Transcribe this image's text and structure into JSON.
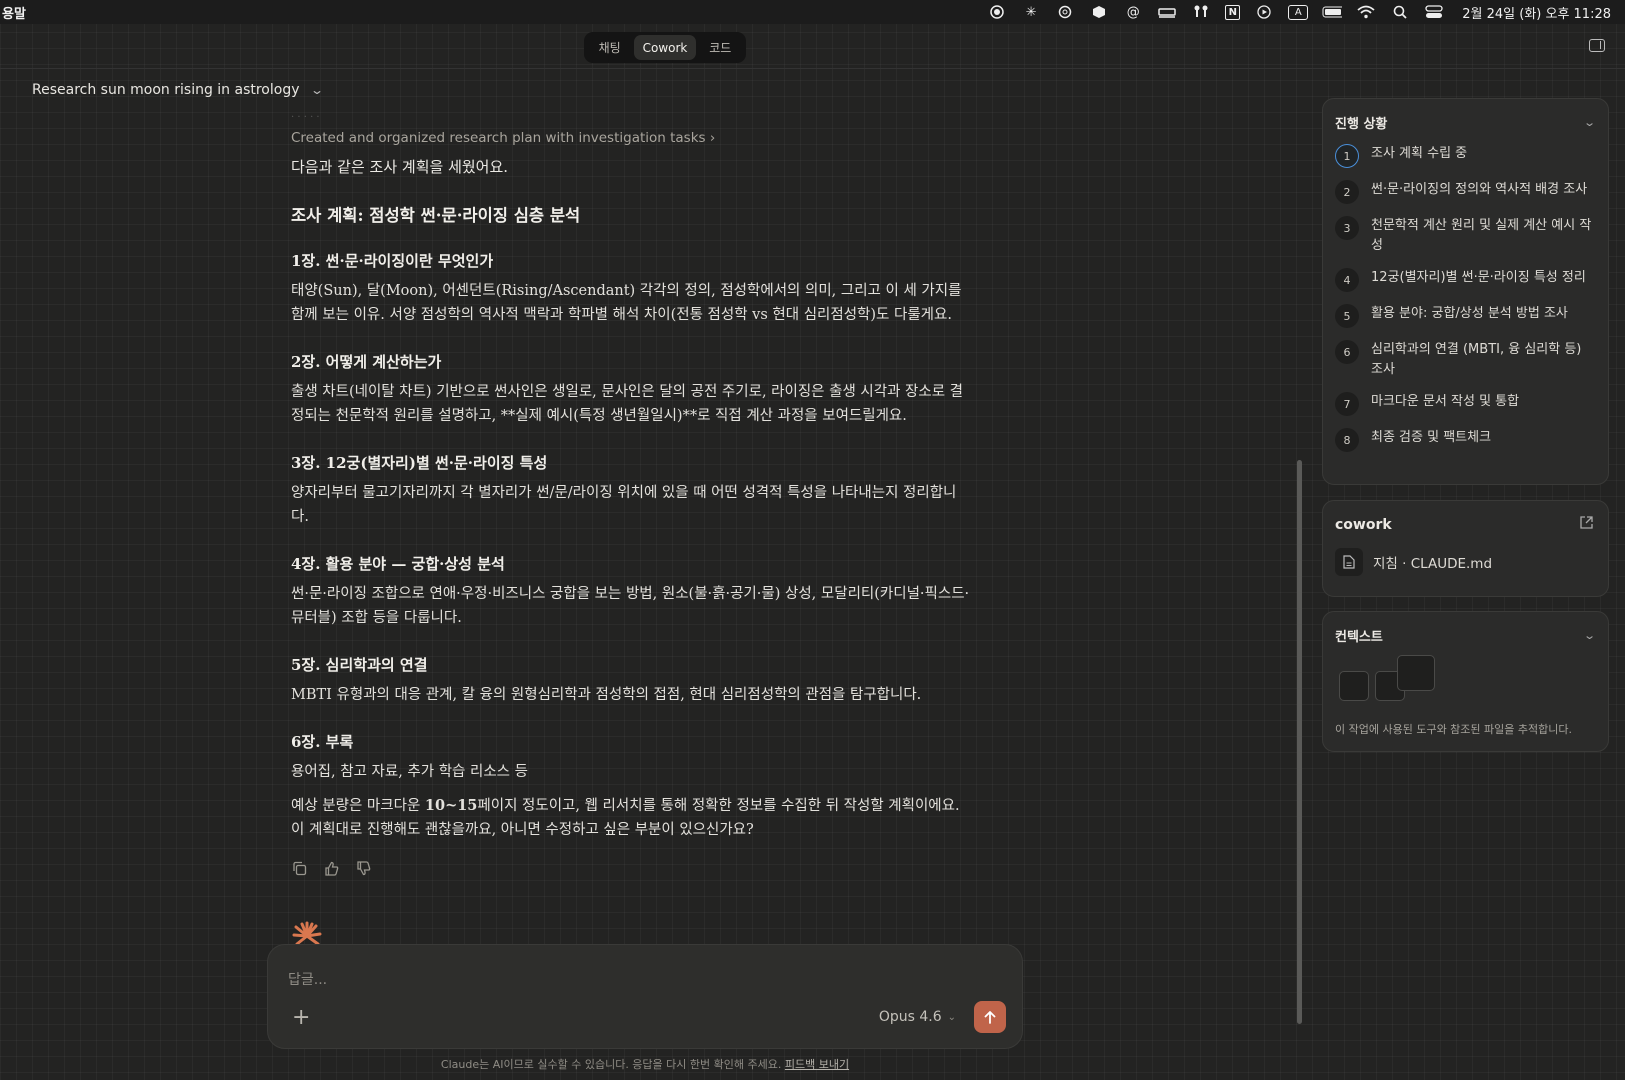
{
  "menubar": {
    "app_name": "용말",
    "clock": "2월 24일 (화) 오후 11:28",
    "icons": [
      "record-icon",
      "claude-spark-icon",
      "openai-icon",
      "box-icon",
      "at-icon",
      "bed-icon",
      "airpods-icon",
      "notion-icon",
      "play-icon",
      "input-source-icon",
      "battery-icon",
      "wifi-icon",
      "search-icon",
      "control-center-icon"
    ],
    "input_source_label": "A",
    "notion_label": "N"
  },
  "mode_tabs": [
    {
      "label": "채팅",
      "active": false
    },
    {
      "label": "Cowork",
      "active": true
    },
    {
      "label": "코드",
      "active": false
    }
  ],
  "conversation": {
    "title": "Research sun moon rising in astrology"
  },
  "message": {
    "task_link": "Created and organized research plan with investigation tasks",
    "intro": "다음과 같은 조사 계획을 세웠어요.",
    "plan_title": "조사 계획: 점성학 썬·문·라이징 심층 분석",
    "chapters": [
      {
        "title": "1장. 썬·문·라이징이란 무엇인가",
        "body": "태양(Sun), 달(Moon), 어센던트(Rising/Ascendant) 각각의 정의, 점성학에서의 의미, 그리고 이 세 가지를 함께 보는 이유. 서양 점성학의 역사적 맥락과 학파별 해석 차이(전통 점성학 vs 현대 심리점성학)도 다룰게요."
      },
      {
        "title": "2장. 어떻게 계산하는가",
        "body": "출생 차트(네이탈 차트) 기반으로 썬사인은 생일로, 문사인은 달의 공전 주기로, 라이징은 출생 시각과 장소로 결정되는 천문학적 원리를 설명하고, **실제 예시(특정 생년월일시)**로 직접 계산 과정을 보여드릴게요."
      },
      {
        "title": "3장. 12궁(별자리)별 썬·문·라이징 특성",
        "body": "양자리부터 물고기자리까지 각 별자리가 썬/문/라이징 위치에 있을 때 어떤 성격적 특성을 나타내는지 정리합니다."
      },
      {
        "title": "4장. 활용 분야 — 궁합·상성 분석",
        "body": "썬·문·라이징 조합으로 연애·우정·비즈니스 궁합을 보는 방법, 원소(불·흙·공기·물) 상성, 모달리티(카디널·픽스드·뮤터블) 조합 등을 다룹니다."
      },
      {
        "title": "5장. 심리학과의 연결",
        "body": "MBTI 유형과의 대응 관계, 칼 융의 원형심리학과 점성학의 접점, 현대 심리점성학의 관점을 탐구합니다."
      },
      {
        "title": "6장. 부록",
        "body": "용어집, 참고 자료, 추가 학습 리소스 등"
      }
    ],
    "outro_pre": "예상 분량은 마크다운 ",
    "outro_bold": "10~15",
    "outro_post": "페이지 정도이고, 웹 리서치를 통해 정확한 정보를 수집한 뒤 작성할 계획이에요. 이 계획대로 진행해도 괜찮을까요, 아니면 수정하고 싶은 부분이 있으신가요?"
  },
  "composer": {
    "placeholder": "답글...",
    "model": "Opus 4.6"
  },
  "disclaimer": {
    "text": "Claude는 AI이므로 실수할 수 있습니다. 응답을 다시 한번 확인해 주세요.",
    "link": "피드백 보내기"
  },
  "sidebar": {
    "progress": {
      "title": "진행 상황",
      "steps": [
        {
          "num": "1",
          "label": "조사 계획 수립 중",
          "active": true
        },
        {
          "num": "2",
          "label": "썬·문·라이징의 정의와 역사적 배경 조사"
        },
        {
          "num": "3",
          "label": "천문학적 계산 원리 및 실제 계산 예시 작성"
        },
        {
          "num": "4",
          "label": "12궁(별자리)별 썬·문·라이징 특성 정리"
        },
        {
          "num": "5",
          "label": "활용 분야: 궁합/상성 분석 방법 조사"
        },
        {
          "num": "6",
          "label": "심리학과의 연결 (MBTI, 융 심리학 등) 조사"
        },
        {
          "num": "7",
          "label": "마크다운 문서 작성 및 통합"
        },
        {
          "num": "8",
          "label": "최종 검증 및 팩트체크"
        }
      ]
    },
    "cowork": {
      "title": "cowork",
      "file": "지침 · CLAUDE.md"
    },
    "context": {
      "title": "컨텍스트",
      "description": "이 작업에 사용된 도구와 참조된 파일을 추적합니다."
    }
  },
  "colors": {
    "accent": "#c0644a",
    "active_step_ring": "#4a8fd9",
    "background": "#232322"
  }
}
